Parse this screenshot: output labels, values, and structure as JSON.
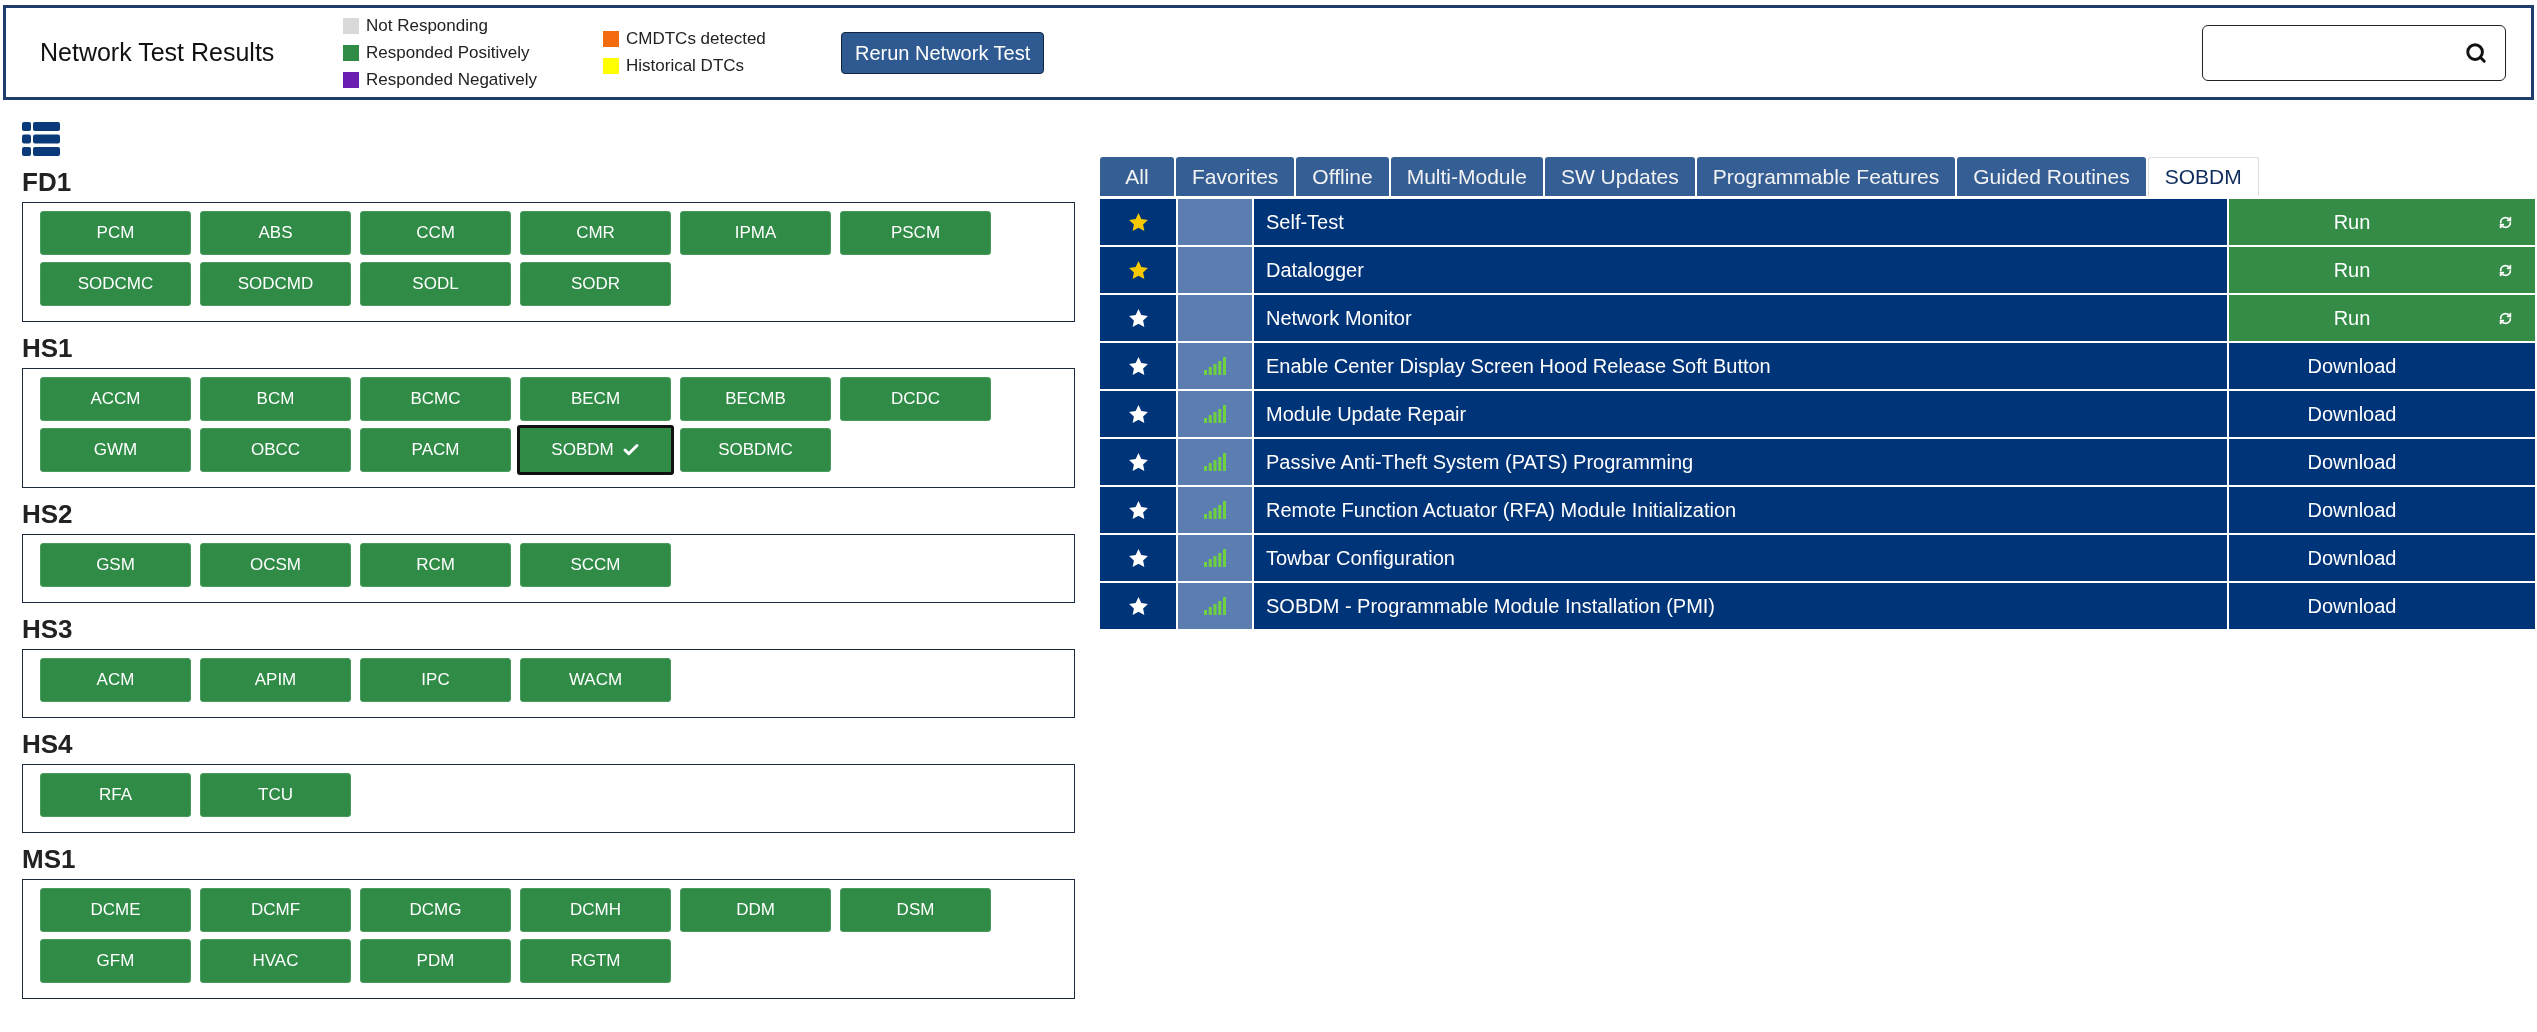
{
  "header": {
    "title": "Network Test Results",
    "legend": [
      {
        "items": [
          {
            "label": "Not Responding",
            "color": "#d9d9d9"
          },
          {
            "label": "Responded Positively",
            "color": "#2f8b46"
          },
          {
            "label": "Responded Negatively",
            "color": "#6a1fb0"
          }
        ]
      },
      {
        "items": [
          {
            "label": "CMDTCs detected",
            "color": "#f26b0f"
          },
          {
            "label": "Historical DTCs",
            "color": "#ffff00"
          }
        ]
      }
    ],
    "rerun_button": "Rerun Network Test"
  },
  "networks": [
    {
      "name": "FD1",
      "modules": [
        {
          "label": "PCM",
          "color": "#2f8b46",
          "selected": false
        },
        {
          "label": "ABS",
          "color": "#2f8b46",
          "selected": false
        },
        {
          "label": "CCM",
          "color": "#2f8b46",
          "selected": false
        },
        {
          "label": "CMR",
          "color": "#2f8b46",
          "selected": false
        },
        {
          "label": "IPMA",
          "color": "#2f8b46",
          "selected": false
        },
        {
          "label": "PSCM",
          "color": "#2f8b46",
          "selected": false
        },
        {
          "label": "SODCMC",
          "color": "#2f8b46",
          "selected": false
        },
        {
          "label": "SODCMD",
          "color": "#2f8b46",
          "selected": false
        },
        {
          "label": "SODL",
          "color": "#2f8b46",
          "selected": false
        },
        {
          "label": "SODR",
          "color": "#2f8b46",
          "selected": false
        }
      ]
    },
    {
      "name": "HS1",
      "modules": [
        {
          "label": "ACCM",
          "color": "#2f8b46",
          "selected": false
        },
        {
          "label": "BCM",
          "color": "#2f8b46",
          "selected": false
        },
        {
          "label": "BCMC",
          "color": "#2f8b46",
          "selected": false
        },
        {
          "label": "BECM",
          "color": "#2f8b46",
          "selected": false
        },
        {
          "label": "BECMB",
          "color": "#2f8b46",
          "selected": false
        },
        {
          "label": "DCDC",
          "color": "#2f8b46",
          "selected": false
        },
        {
          "label": "GWM",
          "color": "#2f8b46",
          "selected": false
        },
        {
          "label": "OBCC",
          "color": "#2f8b46",
          "selected": false
        },
        {
          "label": "PACM",
          "color": "#2f8b46",
          "selected": false
        },
        {
          "label": "SOBDM",
          "color": "#2f8b46",
          "selected": true
        },
        {
          "label": "SOBDMC",
          "color": "#2f8b46",
          "selected": false
        }
      ]
    },
    {
      "name": "HS2",
      "modules": [
        {
          "label": "GSM",
          "color": "#2f8b46",
          "selected": false
        },
        {
          "label": "OCSM",
          "color": "#2f8b46",
          "selected": false
        },
        {
          "label": "RCM",
          "color": "#2f8b46",
          "selected": false
        },
        {
          "label": "SCCM",
          "color": "#2f8b46",
          "selected": false
        }
      ]
    },
    {
      "name": "HS3",
      "modules": [
        {
          "label": "ACM",
          "color": "#2f8b46",
          "selected": false
        },
        {
          "label": "APIM",
          "color": "#2f8b46",
          "selected": false
        },
        {
          "label": "IPC",
          "color": "#2f8b46",
          "selected": false
        },
        {
          "label": "WACM",
          "color": "#2f8b46",
          "selected": false
        }
      ]
    },
    {
      "name": "HS4",
      "modules": [
        {
          "label": "RFA",
          "color": "#2f8b46",
          "selected": false
        },
        {
          "label": "TCU",
          "color": "#2f8b46",
          "selected": false
        }
      ]
    },
    {
      "name": "MS1",
      "modules": [
        {
          "label": "DCME",
          "color": "#2f8b46",
          "selected": false
        },
        {
          "label": "DCMF",
          "color": "#2f8b46",
          "selected": false
        },
        {
          "label": "DCMG",
          "color": "#2f8b46",
          "selected": false
        },
        {
          "label": "DCMH",
          "color": "#2f8b46",
          "selected": false
        },
        {
          "label": "DDM",
          "color": "#2f8b46",
          "selected": false
        },
        {
          "label": "DSM",
          "color": "#2f8b46",
          "selected": false
        },
        {
          "label": "GFM",
          "color": "#2f8b46",
          "selected": false
        },
        {
          "label": "HVAC",
          "color": "#2f8b46",
          "selected": false
        },
        {
          "label": "PDM",
          "color": "#2f8b46",
          "selected": false
        },
        {
          "label": "RGTM",
          "color": "#2f8b46",
          "selected": false
        }
      ]
    }
  ],
  "tabs": [
    {
      "label": "All",
      "selected": false
    },
    {
      "label": "Favorites",
      "selected": false
    },
    {
      "label": "Offline",
      "selected": false
    },
    {
      "label": "Multi-Module",
      "selected": false
    },
    {
      "label": "SW Updates",
      "selected": false
    },
    {
      "label": "Programmable Features",
      "selected": false
    },
    {
      "label": "Guided Routines",
      "selected": false
    },
    {
      "label": "SOBDM",
      "selected": true
    }
  ],
  "routines": [
    {
      "name": "Self-Test",
      "favorite": true,
      "signal": false,
      "action": {
        "label": "Run",
        "kind": "run"
      }
    },
    {
      "name": "Datalogger",
      "favorite": true,
      "signal": false,
      "action": {
        "label": "Run",
        "kind": "run"
      }
    },
    {
      "name": "Network Monitor",
      "favorite": false,
      "signal": false,
      "action": {
        "label": "Run",
        "kind": "run"
      }
    },
    {
      "name": "Enable Center Display Screen Hood Release Soft Button",
      "favorite": false,
      "signal": true,
      "action": {
        "label": "Download",
        "kind": "download"
      }
    },
    {
      "name": "Module Update Repair",
      "favorite": false,
      "signal": true,
      "action": {
        "label": "Download",
        "kind": "download"
      }
    },
    {
      "name": "Passive Anti-Theft System (PATS) Programming",
      "favorite": false,
      "signal": true,
      "action": {
        "label": "Download",
        "kind": "download"
      }
    },
    {
      "name": "Remote Function Actuator (RFA) Module Initialization",
      "favorite": false,
      "signal": true,
      "action": {
        "label": "Download",
        "kind": "download"
      }
    },
    {
      "name": "Towbar Configuration",
      "favorite": false,
      "signal": true,
      "action": {
        "label": "Download",
        "kind": "download"
      }
    },
    {
      "name": "SOBDM - Programmable Module Installation (PMI)",
      "favorite": false,
      "signal": true,
      "action": {
        "label": "Download",
        "kind": "download"
      }
    }
  ]
}
